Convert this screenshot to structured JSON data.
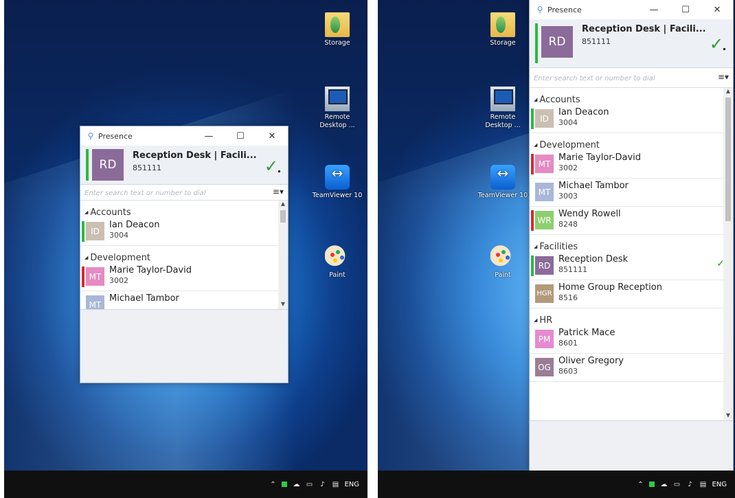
{
  "desktop": {
    "icons": [
      {
        "label": "Storage",
        "icon": "folder-icon"
      },
      {
        "label": "Remote Desktop ...",
        "icon": "remote-desktop-icon"
      },
      {
        "label": "TeamViewer 10",
        "icon": "teamviewer-icon"
      },
      {
        "label": "Paint",
        "icon": "paint-icon"
      }
    ]
  },
  "taskbar": {
    "language": "ENG"
  },
  "app": {
    "title": "Presence",
    "me": {
      "initials": "RD",
      "name": "Reception Desk | Facili...",
      "number": "851111"
    },
    "search_placeholder": "Enter search text or number to dial"
  },
  "groups": [
    {
      "name": "Accounts",
      "contacts": [
        {
          "initials": "ID",
          "name": "Ian Deacon",
          "number": "3004",
          "status": "green",
          "avatar_color": "#cbbfb2"
        }
      ]
    },
    {
      "name": "Development",
      "contacts": [
        {
          "initials": "MT",
          "name": "Marie Taylor-David",
          "number": "3002",
          "status": "red",
          "avatar_color": "#e58bc1"
        },
        {
          "initials": "MT",
          "name": "Michael Tambor",
          "number": "3003",
          "status": "none",
          "avatar_color": "#a9b7d8"
        },
        {
          "initials": "WR",
          "name": "Wendy Rowell",
          "number": "8248",
          "status": "red",
          "avatar_color": "#8dcf6f"
        }
      ]
    },
    {
      "name": "Facilities",
      "contacts": [
        {
          "initials": "RD",
          "name": "Reception Desk",
          "number": "851111",
          "status": "green",
          "avatar_color": "#8b6b99",
          "check": "✓"
        },
        {
          "initials": "HGR",
          "name": "Home Group Reception",
          "number": "8516",
          "status": "none",
          "avatar_color": "#b39a7c"
        }
      ]
    },
    {
      "name": "HR",
      "contacts": [
        {
          "initials": "PM",
          "name": "Patrick Mace",
          "number": "8601",
          "status": "none",
          "avatar_color": "#e58bd0"
        },
        {
          "initials": "OG",
          "name": "Oliver Gregory",
          "number": "8603",
          "status": "none",
          "avatar_color": "#9a7d96"
        }
      ]
    }
  ],
  "colors": {
    "online": "#2bba3b",
    "busy": "#e0262b",
    "accent": "#5a8fd9"
  }
}
